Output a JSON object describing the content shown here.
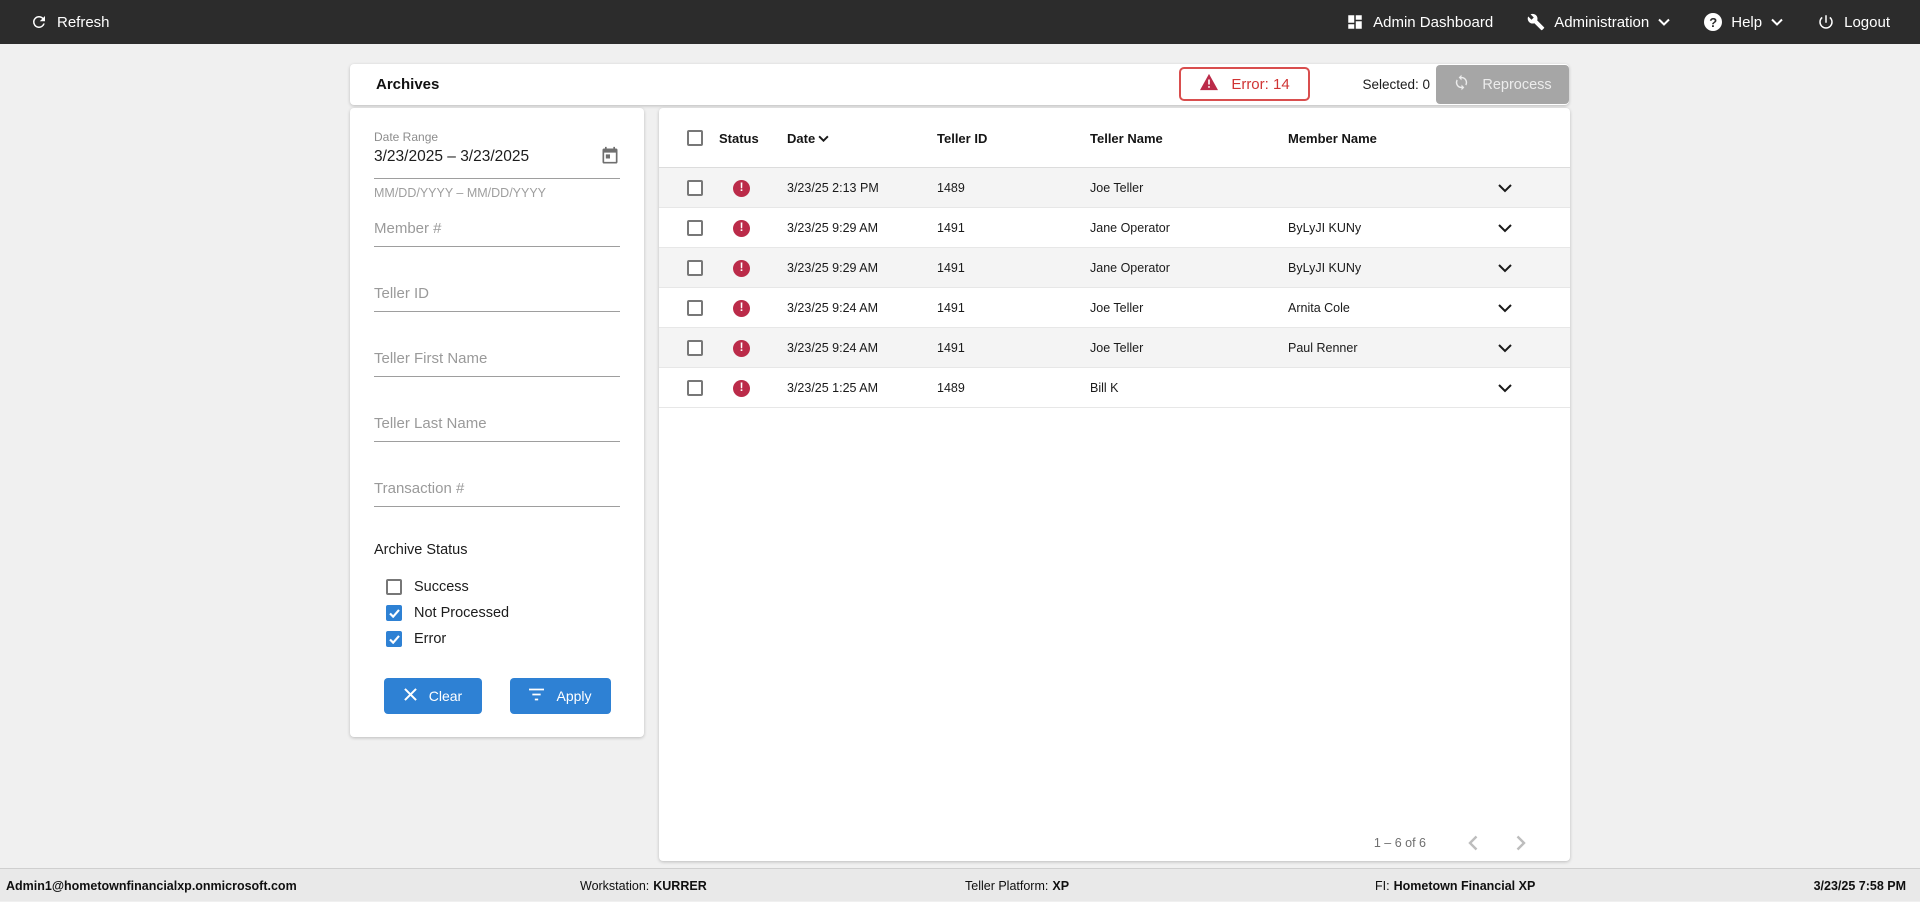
{
  "topbar": {
    "refresh": "Refresh",
    "admin_dashboard": "Admin Dashboard",
    "administration": "Administration",
    "help": "Help",
    "logout": "Logout"
  },
  "header": {
    "title": "Archives",
    "error_badge": "Error: 14",
    "selected": "Selected: 0",
    "reprocess": "Reprocess"
  },
  "filters": {
    "date_range_label": "Date Range",
    "date_range_value": "3/23/2025 – 3/23/2025",
    "date_range_hint": "MM/DD/YYYY – MM/DD/YYYY",
    "member_placeholder": "Member #",
    "teller_id_placeholder": "Teller ID",
    "teller_first_placeholder": "Teller First Name",
    "teller_last_placeholder": "Teller Last Name",
    "transaction_placeholder": "Transaction #",
    "archive_status_label": "Archive Status",
    "archive_status_options": [
      {
        "label": "Success",
        "checked": false
      },
      {
        "label": "Not Processed",
        "checked": true
      },
      {
        "label": "Error",
        "checked": true
      }
    ],
    "clear_label": "Clear",
    "apply_label": "Apply"
  },
  "table": {
    "columns": {
      "status": "Status",
      "date": "Date",
      "teller_id": "Teller ID",
      "teller_name": "Teller Name",
      "member_name": "Member Name"
    },
    "sort_column": "Date",
    "rows": [
      {
        "status": "error",
        "date": "3/23/25 2:13 PM",
        "teller_id": "1489",
        "teller_name": "Joe Teller",
        "member_name": ""
      },
      {
        "status": "error",
        "date": "3/23/25 9:29 AM",
        "teller_id": "1491",
        "teller_name": "Jane Operator",
        "member_name": "ByLyJI KUNy"
      },
      {
        "status": "error",
        "date": "3/23/25 9:29 AM",
        "teller_id": "1491",
        "teller_name": "Jane Operator",
        "member_name": "ByLyJI KUNy"
      },
      {
        "status": "error",
        "date": "3/23/25 9:24 AM",
        "teller_id": "1491",
        "teller_name": "Joe Teller",
        "member_name": "Arnita Cole"
      },
      {
        "status": "error",
        "date": "3/23/25 9:24 AM",
        "teller_id": "1491",
        "teller_name": "Joe Teller",
        "member_name": "Paul Renner"
      },
      {
        "status": "error",
        "date": "3/23/25 1:25 AM",
        "teller_id": "1489",
        "teller_name": "Bill K",
        "member_name": ""
      }
    ],
    "pagination": "1 – 6 of 6"
  },
  "statusbar": {
    "user": "Admin1@hometownfinancialxp.onmicrosoft.com",
    "workstation_label": "Workstation:",
    "workstation_value": "KURRER",
    "platform_label": "Teller Platform:",
    "platform_value": "XP",
    "fi_label": "FI:",
    "fi_value": "Hometown Financial XP",
    "datetime": "3/23/25 7:58 PM"
  },
  "colors": {
    "topbar_bg": "#2c2c2c",
    "page_bg": "#f0f0f0",
    "accent_blue": "#2e81d4",
    "error_red": "#bb2b49",
    "error_badge_border": "#d94e4e",
    "error_badge_text": "#d03434",
    "disabled_button_bg": "#a6a6a6",
    "row_alt_bg": "#f4f4f4"
  }
}
